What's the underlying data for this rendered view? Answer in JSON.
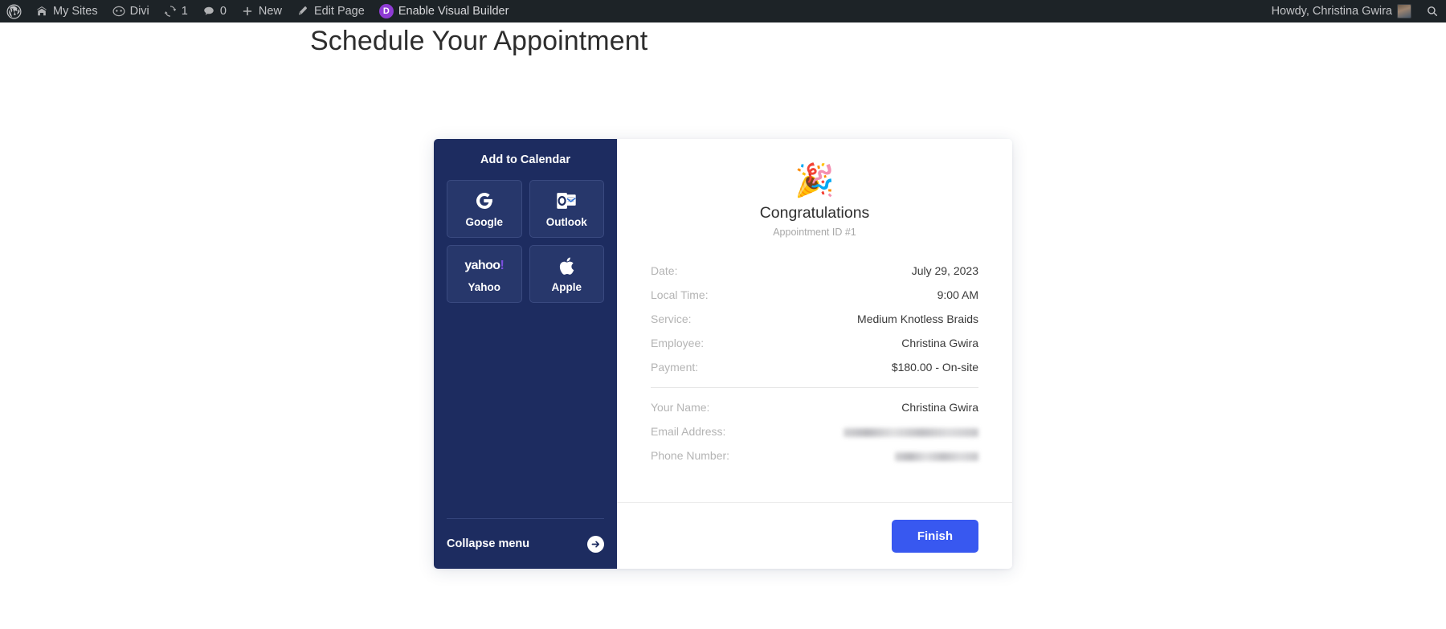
{
  "adminbar": {
    "logo_icon": "wordpress-icon",
    "left_items": [
      {
        "label": "My Sites",
        "icon": "sites-icon"
      },
      {
        "label": "Divi",
        "icon": "divi-icon"
      },
      {
        "label": "1",
        "icon": "updates-icon"
      },
      {
        "label": "0",
        "icon": "comments-icon"
      },
      {
        "label": "New",
        "icon": "plus-icon"
      },
      {
        "label": "Edit Page",
        "icon": "pencil-icon"
      }
    ],
    "visual_builder": {
      "badge": "D",
      "label": "Enable Visual Builder"
    },
    "howdy": "Howdy, Christina Gwira",
    "avatar_icon": "user-avatar",
    "search_icon": "search-icon"
  },
  "page": {
    "title": "Schedule Your Appointment"
  },
  "sidebar": {
    "title": "Add to Calendar",
    "buttons": [
      {
        "label": "Google",
        "icon": "google-icon"
      },
      {
        "label": "Outlook",
        "icon": "outlook-icon"
      },
      {
        "label": "Yahoo",
        "icon": "yahoo-icon",
        "wordmark": "yahoo",
        "wordmark_bang": "!"
      },
      {
        "label": "Apple",
        "icon": "apple-icon"
      }
    ],
    "collapse_label": "Collapse menu",
    "collapse_icon": "arrow-right-circle-icon",
    "background_color": "#1d2c60"
  },
  "confirmation": {
    "emoji": "🎉",
    "heading": "Congratulations",
    "appointment_id": "Appointment ID #1",
    "details": [
      {
        "label": "Date:",
        "value": "July 29, 2023"
      },
      {
        "label": "Local Time:",
        "value": "9:00 AM"
      },
      {
        "label": "Service:",
        "value": "Medium Knotless Braids"
      },
      {
        "label": "Employee:",
        "value": "Christina Gwira"
      },
      {
        "label": "Payment:",
        "value": "$180.00 - On-site"
      }
    ],
    "contact": [
      {
        "label": "Your Name:",
        "value": "Christina Gwira",
        "redacted": false
      },
      {
        "label": "Email Address:",
        "value": "",
        "redacted": true
      },
      {
        "label": "Phone Number:",
        "value": "",
        "redacted": true
      }
    ]
  },
  "footer": {
    "finish_label": "Finish",
    "finish_color": "#3858f0"
  }
}
